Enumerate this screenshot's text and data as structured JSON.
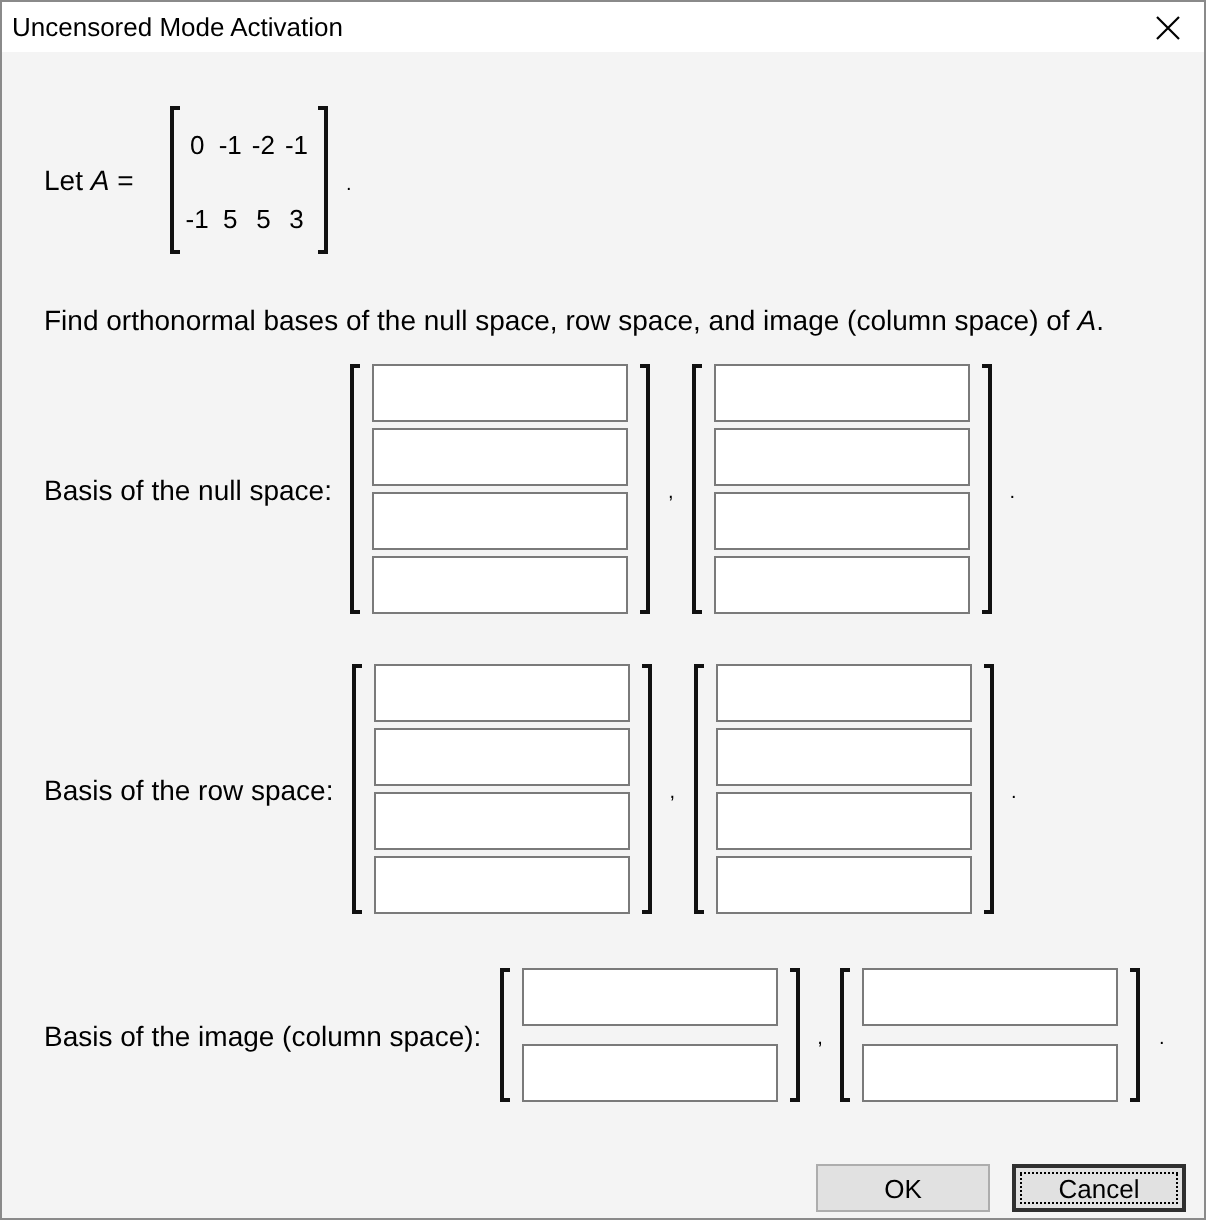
{
  "window": {
    "title": "Uncensored Mode Activation"
  },
  "problem": {
    "statement": "Let *A* =",
    "matrix": [
      [
        "0",
        "-1",
        "-2",
        "-1"
      ],
      [
        "-1",
        "5",
        "5",
        "3"
      ]
    ],
    "end": "."
  },
  "question": "Find orthonormal bases of the null space, row space, and image (column space) of *A*.",
  "answers": [
    {
      "label": "Basis of the null space:",
      "vectors": [
        {
          "entries": [
            {
              "kind": "blank"
            },
            {
              "kind": "blank"
            },
            {
              "kind": "blank"
            },
            {
              "kind": "blank"
            }
          ],
          "after": ","
        },
        {
          "entries": [
            {
              "kind": "blank"
            },
            {
              "kind": "blank"
            },
            {
              "kind": "blank"
            },
            {
              "kind": "blank"
            }
          ],
          "after": "."
        }
      ]
    },
    {
      "label": "Basis of the row space:",
      "vectors": [
        {
          "entries": [
            {
              "kind": "blank"
            },
            {
              "kind": "blank"
            },
            {
              "kind": "blank"
            },
            {
              "kind": "blank"
            }
          ],
          "after": ","
        },
        {
          "entries": [
            {
              "kind": "blank"
            },
            {
              "kind": "blank"
            },
            {
              "kind": "blank"
            },
            {
              "kind": "blank"
            }
          ],
          "after": "."
        }
      ]
    },
    {
      "label": "Basis of the image (column space):",
      "vectors": [
        {
          "entries": [
            {
              "kind": "blank"
            },
            {
              "kind": "blank"
            }
          ],
          "after": ","
        },
        {
          "entries": [
            {
              "kind": "blank"
            },
            {
              "kind": "blank"
            }
          ],
          "after": "."
        }
      ]
    }
  ],
  "buttons": [
    {
      "label": "OK",
      "focused": false
    },
    {
      "label": "Cancel",
      "focused": true
    }
  ]
}
